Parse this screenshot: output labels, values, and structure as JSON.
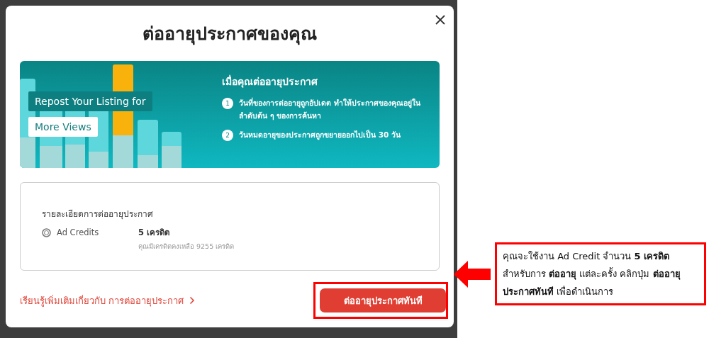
{
  "dialog": {
    "title": "ต่ออายุประกาศของคุณ"
  },
  "banner": {
    "headline_line_1": "Repost Your Listing for",
    "headline_line_2": "More Views",
    "heading": "เมื่อคุณต่ออายุประกาศ",
    "steps": [
      {
        "number": "1",
        "text": "วันที่ของการต่ออายุถูกอัปเดต ทำให้ประกาศของคุณอยู่ในลำดับต้น ๆ ของการค้นหา"
      },
      {
        "number": "2",
        "text": "วันหมดอายุของประกาศถูกขยายออกไปเป็น 30 วัน"
      }
    ]
  },
  "details": {
    "title": "รายละเอียดการต่ออายุประกาศ",
    "label": "Ad Credits",
    "amount": "5 เครดิต",
    "balance": "คุณมีเครดิตคงเหลือ 9255 เครดิต"
  },
  "learn_more_link": "เรียนรู้เพิ่มเติมเกี่ยวกับ การต่ออายุประกาศ",
  "confirm_button": "ต่ออายุประกาศทันที",
  "annotation": {
    "text": "คุณจะใช้งาน Ad Credit จำนวน **5 เครดิต** สำหรับการ **ต่ออายุ** แต่ละครั้ง คลิกปุ่ม **ต่ออายุประกาศทันที** เพื่อดำเนินการ"
  }
}
